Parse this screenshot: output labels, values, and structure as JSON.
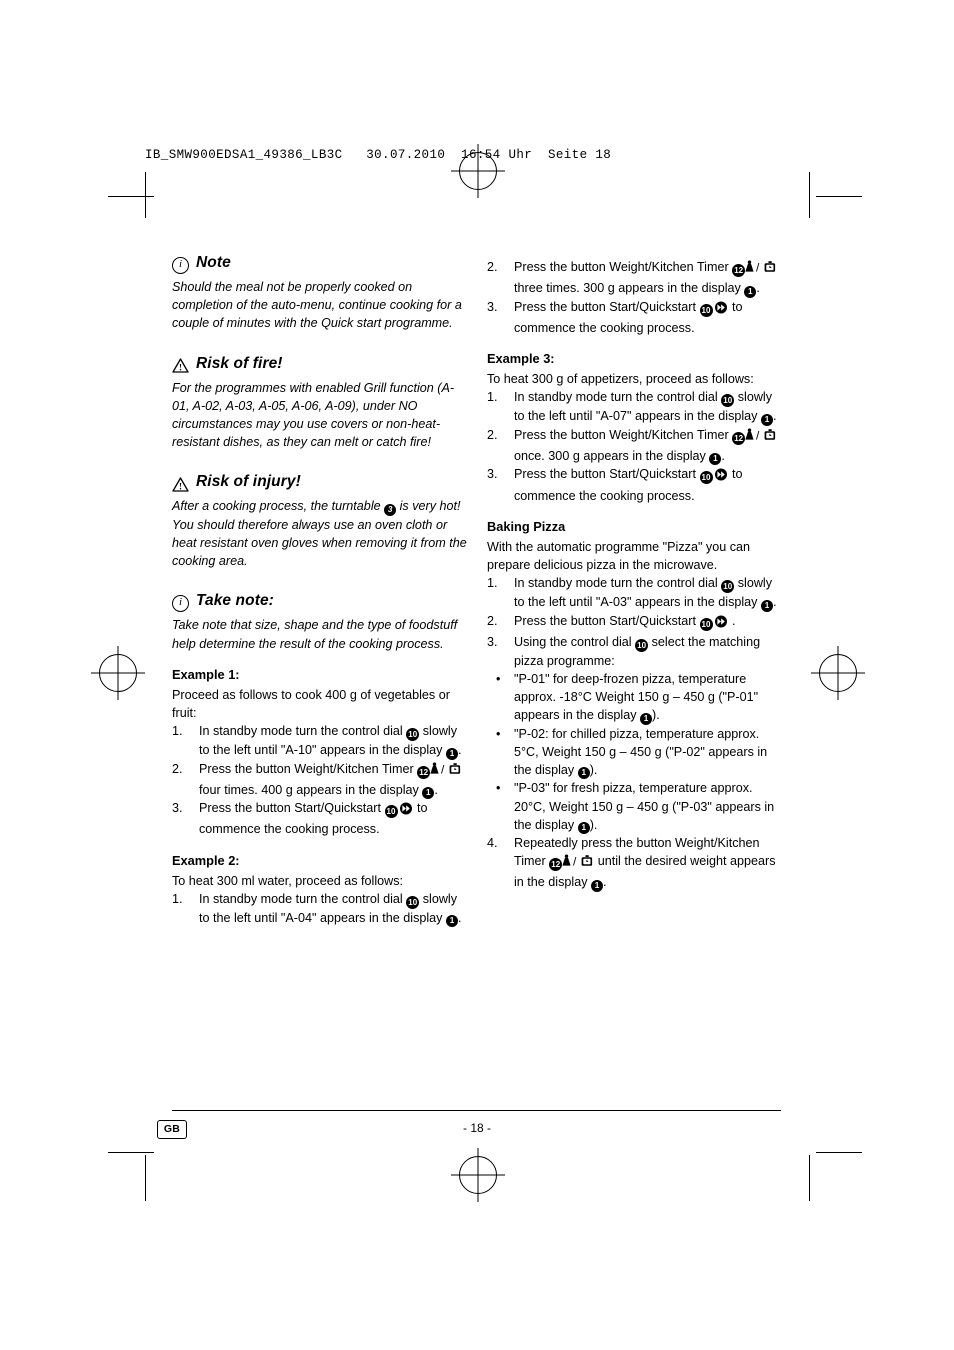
{
  "header": {
    "line": "IB_SMW900EDSA1_49386_LB3C   30.07.2010  16:54 Uhr  Seite 18"
  },
  "footer": {
    "locale": "GB",
    "page": "- 18 -"
  },
  "left_column": {
    "note": {
      "icon": "info-icon",
      "title": "Note",
      "body": "Should the meal not be properly cooked on completion of the auto-menu, continue cooking for a couple of minutes with the Quick start programme."
    },
    "fire": {
      "icon": "warning-triangle-icon",
      "title": "Risk of fire!",
      "body": "For the programmes with enabled Grill function (A-01, A-02, A-03, A-05, A-06, A-09), under NO circumstances may you use covers or non-heat-resistant dishes, as they can melt or catch fire!"
    },
    "injury": {
      "icon": "warning-triangle-icon",
      "title": "Risk of injury!",
      "body_1": "After a cooking process, the turntable",
      "ref_turntable": "3",
      "body_2": "is very hot! You should therefore always use an oven cloth or heat resistant oven gloves when removing it from the cooking area."
    },
    "take_note": {
      "icon": "info-icon",
      "title": "Take note:",
      "body": "Take note that size, shape and the type of foodstuff help determine the result of the cooking process."
    },
    "example1": {
      "title": "Example 1:",
      "intro": "Proceed as follows to cook 400 g of vegetables or fruit:",
      "steps": [
        {
          "num": "1.",
          "parts": [
            {
              "t": "text",
              "v": "In standby mode turn the control dial "
            },
            {
              "t": "ref",
              "v": "10"
            },
            {
              "t": "text",
              "v": " slowly to the left until \"A-10\" appears in the display "
            },
            {
              "t": "ref",
              "v": "1"
            },
            {
              "t": "text",
              "v": "."
            }
          ]
        },
        {
          "num": "2.",
          "parts": [
            {
              "t": "text",
              "v": "Press the button Weight/Kitchen Timer "
            },
            {
              "t": "ref",
              "v": "12"
            },
            {
              "t": "icon",
              "v": "weight-kitchen-timer-icon"
            },
            {
              "t": "text",
              "v": " four times. 400 g appears in the display "
            },
            {
              "t": "ref",
              "v": "1"
            },
            {
              "t": "text",
              "v": "."
            }
          ]
        },
        {
          "num": "3.",
          "parts": [
            {
              "t": "text",
              "v": "Press the button Start/Quickstart "
            },
            {
              "t": "ref",
              "v": "10"
            },
            {
              "t": "icon",
              "v": "quickstart-icon"
            },
            {
              "t": "text",
              "v": " to commence the cooking process."
            }
          ]
        }
      ]
    },
    "example2": {
      "title": "Example 2:",
      "intro": "To heat 300 ml water, proceed as follows:",
      "steps": [
        {
          "num": "1.",
          "parts": [
            {
              "t": "text",
              "v": "In standby mode turn the control dial "
            },
            {
              "t": "ref",
              "v": "10"
            },
            {
              "t": "text",
              "v": " slowly to the left until \"A-04\" appears in the display "
            },
            {
              "t": "ref",
              "v": "1"
            },
            {
              "t": "text",
              "v": "."
            }
          ]
        }
      ]
    }
  },
  "right_column": {
    "example2_cont": {
      "steps": [
        {
          "num": "2.",
          "parts": [
            {
              "t": "text",
              "v": "Press the button Weight/Kitchen Timer "
            },
            {
              "t": "ref",
              "v": "12"
            },
            {
              "t": "icon",
              "v": "weight-kitchen-timer-icon"
            },
            {
              "t": "text",
              "v": " three times. 300 g appears in the display "
            },
            {
              "t": "ref",
              "v": "1"
            },
            {
              "t": "text",
              "v": "."
            }
          ]
        },
        {
          "num": "3.",
          "parts": [
            {
              "t": "text",
              "v": "Press the button Start/Quickstart "
            },
            {
              "t": "ref",
              "v": "10"
            },
            {
              "t": "icon",
              "v": "quickstart-icon"
            },
            {
              "t": "text",
              "v": " to commence the cooking process."
            }
          ]
        }
      ]
    },
    "example3": {
      "title": "Example 3:",
      "intro": "To heat 300 g of appetizers, proceed as follows:",
      "steps": [
        {
          "num": "1.",
          "parts": [
            {
              "t": "text",
              "v": "In standby mode turn the control dial "
            },
            {
              "t": "ref",
              "v": "10"
            },
            {
              "t": "text",
              "v": " slowly to the left until \"A-07\" appears in the display "
            },
            {
              "t": "ref",
              "v": "1"
            },
            {
              "t": "text",
              "v": "."
            }
          ]
        },
        {
          "num": "2.",
          "parts": [
            {
              "t": "text",
              "v": "Press the button Weight/Kitchen Timer "
            },
            {
              "t": "ref",
              "v": "12"
            },
            {
              "t": "icon",
              "v": "weight-kitchen-timer-icon"
            },
            {
              "t": "text",
              "v": " once. 300 g appears in the display "
            },
            {
              "t": "ref",
              "v": "1"
            },
            {
              "t": "text",
              "v": "."
            }
          ]
        },
        {
          "num": "3.",
          "parts": [
            {
              "t": "text",
              "v": "Press the button Start/Quickstart "
            },
            {
              "t": "ref",
              "v": "10"
            },
            {
              "t": "icon",
              "v": "quickstart-icon"
            },
            {
              "t": "text",
              "v": " to commence the cooking process."
            }
          ]
        }
      ]
    },
    "pizza": {
      "title": "Baking Pizza",
      "intro": "With the automatic programme \"Pizza\" you can prepare delicious pizza in the microwave.",
      "steps": [
        {
          "num": "1.",
          "parts": [
            {
              "t": "text",
              "v": "In standby mode turn the control dial "
            },
            {
              "t": "ref",
              "v": "10"
            },
            {
              "t": "text",
              "v": " slowly to the left until \"A-03\" appears in the display "
            },
            {
              "t": "ref",
              "v": "1"
            },
            {
              "t": "text",
              "v": "."
            }
          ]
        },
        {
          "num": "2.",
          "parts": [
            {
              "t": "text",
              "v": "Press the button Start/Quickstart "
            },
            {
              "t": "ref",
              "v": "10"
            },
            {
              "t": "icon",
              "v": "quickstart-icon"
            },
            {
              "t": "text",
              "v": " ."
            }
          ]
        },
        {
          "num": "3.",
          "parts": [
            {
              "t": "text",
              "v": "Using the control dial "
            },
            {
              "t": "ref",
              "v": "10"
            },
            {
              "t": "text",
              "v": " select the matching pizza programme:"
            }
          ]
        }
      ],
      "bullets": [
        {
          "parts": [
            {
              "t": "text",
              "v": "\"P-01\" for deep-frozen pizza, temperature approx. -18°C Weight 150 g – 450 g (\"P-01\" appears in the display "
            },
            {
              "t": "ref",
              "v": "1"
            },
            {
              "t": "text",
              "v": ")."
            }
          ]
        },
        {
          "parts": [
            {
              "t": "text",
              "v": "\"P-02: for chilled pizza, temperature approx. 5°C, Weight 150 g – 450 g (\"P-02\" appears in the display "
            },
            {
              "t": "ref",
              "v": "1"
            },
            {
              "t": "text",
              "v": ")."
            }
          ]
        },
        {
          "parts": [
            {
              "t": "text",
              "v": "\"P-03\" for fresh pizza, temperature approx. 20°C, Weight 150 g – 450 g (\"P-03\" appears in the display "
            },
            {
              "t": "ref",
              "v": "1"
            },
            {
              "t": "text",
              "v": ")."
            }
          ]
        }
      ],
      "final_step": {
        "num": "4.",
        "parts": [
          {
            "t": "text",
            "v": "Repeatedly press the button Weight/Kitchen Timer "
          },
          {
            "t": "ref",
            "v": "12"
          },
          {
            "t": "icon",
            "v": "weight-kitchen-timer-icon"
          },
          {
            "t": "text",
            "v": " until the desired weight appears in the display "
          },
          {
            "t": "ref",
            "v": "1"
          },
          {
            "t": "text",
            "v": "."
          }
        ]
      }
    }
  }
}
